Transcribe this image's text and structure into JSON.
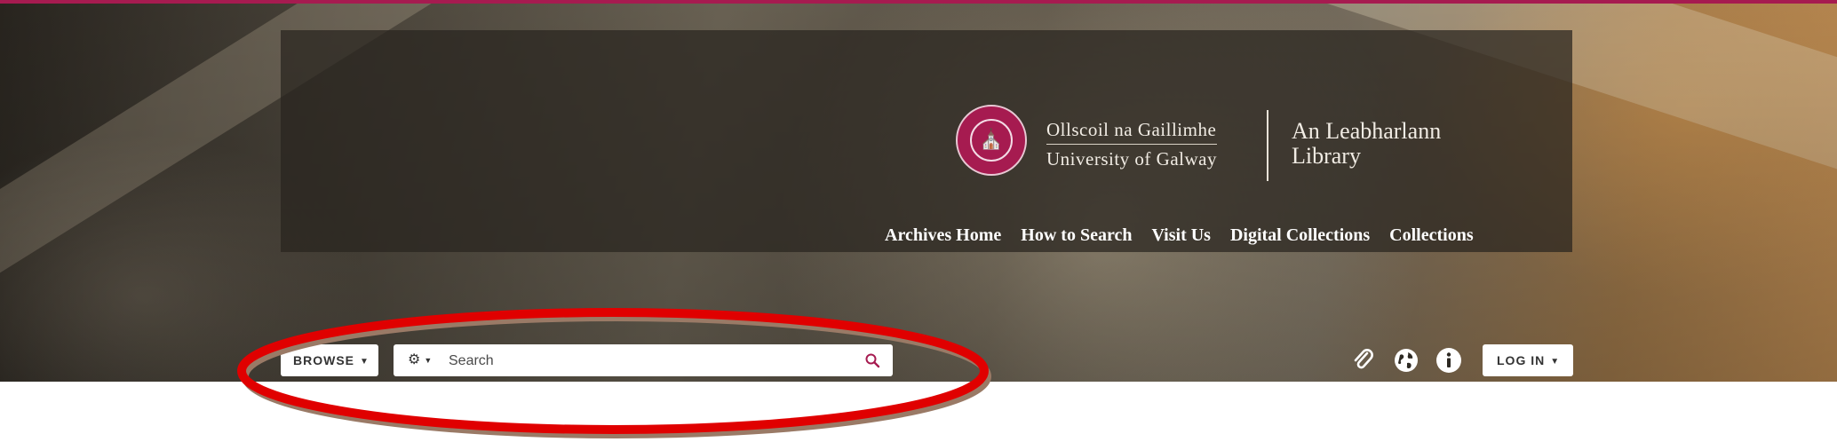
{
  "header": {
    "university_line1": "Ollscoil na Gaillimhe",
    "university_line2": "University of Galway",
    "library_line1": "An Leabharlann",
    "library_line2": "Library",
    "seal_glyph": "⛪"
  },
  "nav": {
    "items": [
      {
        "label": "Archives Home"
      },
      {
        "label": "How to Search"
      },
      {
        "label": "Visit Us"
      },
      {
        "label": "Digital Collections"
      },
      {
        "label": "Collections"
      }
    ]
  },
  "toolbar": {
    "browse_label": "BROWSE",
    "search_placeholder": "Search",
    "login_label": "LOG IN"
  },
  "icons": {
    "gear": "gear-icon",
    "search": "search-icon",
    "clipboard": "paperclip-icon",
    "language": "globe-icon",
    "info": "info-icon"
  },
  "colors": {
    "brand": "#a61b50",
    "annotation": "#e00000"
  }
}
